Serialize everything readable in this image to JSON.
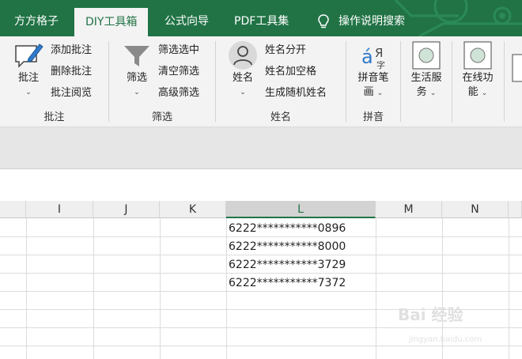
{
  "tabs": [
    {
      "label": "方方格子",
      "active": false
    },
    {
      "label": "DIY工具箱",
      "active": true
    },
    {
      "label": "公式向导",
      "active": false
    },
    {
      "label": "PDF工具集",
      "active": false
    },
    {
      "label": "操作说明搜索",
      "active": false
    }
  ],
  "ribbon": {
    "annotate": {
      "big_label": "批注",
      "small": [
        "添加批注",
        "删除批注",
        "批注阅览"
      ],
      "group_label": "批注"
    },
    "filter": {
      "big_label": "筛选",
      "small": [
        "筛选选中",
        "清空筛选",
        "高级筛选"
      ],
      "group_label": "筛选"
    },
    "name": {
      "big_label": "姓名",
      "small": [
        "姓名分开",
        "姓名加空格",
        "生成随机姓名"
      ],
      "group_label": "姓名"
    },
    "pinyin": {
      "big_label_1": "拼音笔",
      "big_label_2": "画",
      "group_label": "拼音"
    },
    "life": {
      "label_1": "生活服",
      "label_2": "务"
    },
    "online": {
      "label_1": "在线功",
      "label_2": "能"
    }
  },
  "sheet": {
    "columns": [
      "I",
      "J",
      "K",
      "L",
      "M",
      "N"
    ],
    "selected_column": "L",
    "cells_L": [
      "6222***********0896",
      "6222***********8000",
      "6222***********3729",
      "6222***********7372"
    ]
  },
  "watermark": {
    "text": "Bai 经验",
    "sub": "jingyan.baidu.com"
  },
  "colors": {
    "accent": "#217346",
    "ribbon_bg": "#f3f3f3"
  }
}
